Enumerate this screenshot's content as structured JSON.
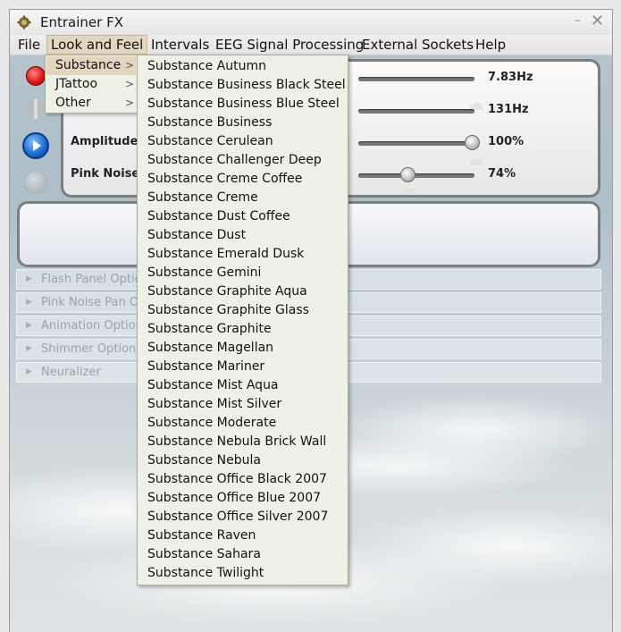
{
  "window": {
    "title": "Entrainer FX",
    "minimize_glyph": "–",
    "close_glyph": "✕",
    "app_icon": "gear-logo-icon"
  },
  "menubar": {
    "items": [
      {
        "label": "File"
      },
      {
        "label": "Look and Feel"
      },
      {
        "label": "Intervals"
      },
      {
        "label": "EEG Signal Processing"
      },
      {
        "label": "External Sockets"
      },
      {
        "label": "Help"
      }
    ]
  },
  "look_and_feel_menu": {
    "items": [
      {
        "label": "Substance",
        "chevron": ">"
      },
      {
        "label": "JTattoo",
        "chevron": ">"
      },
      {
        "label": "Other",
        "chevron": ">"
      }
    ]
  },
  "substance_menu": {
    "items": [
      "Substance Autumn",
      "Substance Business Black Steel",
      "Substance Business Blue Steel",
      "Substance Business",
      "Substance Cerulean",
      "Substance Challenger Deep",
      "Substance Creme Coffee",
      "Substance Creme",
      "Substance Dust Coffee",
      "Substance Dust",
      "Substance Emerald Dusk",
      "Substance Gemini",
      "Substance Graphite Aqua",
      "Substance Graphite Glass",
      "Substance Graphite",
      "Substance Magellan",
      "Substance Mariner",
      "Substance Mist Aqua",
      "Substance Mist Silver",
      "Substance Moderate",
      "Substance Nebula Brick Wall",
      "Substance Nebula",
      "Substance Office Black 2007",
      "Substance Office Blue 2007",
      "Substance Office Silver 2007",
      "Substance Raven",
      "Substance Sahara",
      "Substance Twilight"
    ]
  },
  "controls": {
    "rows": [
      {
        "label": "",
        "value": "7.83Hz",
        "level": 1.0
      },
      {
        "label": "",
        "value": "131Hz",
        "level": 1.0
      },
      {
        "label": "Amplitude",
        "value": "100%",
        "level": 1.0
      },
      {
        "label": "Pink Noise",
        "value": "74%",
        "level": 0.74
      }
    ],
    "buttons": [
      "record-icon",
      "pause-icon",
      "play-icon",
      "stop-icon"
    ]
  },
  "collapsible_panels": [
    {
      "label": "Flash Panel Optio"
    },
    {
      "label": "Pink Noise Pan Op"
    },
    {
      "label": "Animation Option"
    },
    {
      "label": "Shimmer Options"
    },
    {
      "label": "Neuralizer"
    }
  ],
  "colors": {
    "menu_bg": "#eef2e6",
    "active_menu_bg": "#e2d6bf",
    "play_button": "#1f6fd6",
    "record_button": "#e01818"
  }
}
